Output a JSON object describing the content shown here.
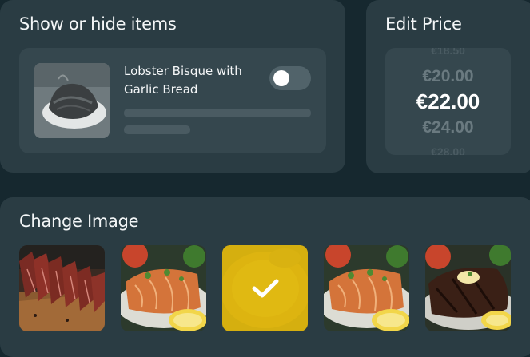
{
  "visibility_panel": {
    "title": "Show or hide items",
    "item": {
      "name": "Lobster Bisque with Garlic Bread",
      "visible": false,
      "thumbnail_icon": "steak-photo-grayscale"
    }
  },
  "price_panel": {
    "title": "Edit Price",
    "options": [
      "€18.50",
      "€20.00",
      "€22.00",
      "€24.00",
      "€28.00"
    ],
    "selected": "€22.00"
  },
  "image_panel": {
    "title": "Change Image",
    "images": [
      {
        "icon": "sliced-steak-photo",
        "selected": false
      },
      {
        "icon": "salmon-fillet-photo",
        "selected": false
      },
      {
        "icon": "bisque-soup-photo",
        "selected": true
      },
      {
        "icon": "salmon-fillet-photo",
        "selected": false
      },
      {
        "icon": "grilled-steak-photo",
        "selected": false
      }
    ],
    "selection_color": "#deb80c"
  }
}
